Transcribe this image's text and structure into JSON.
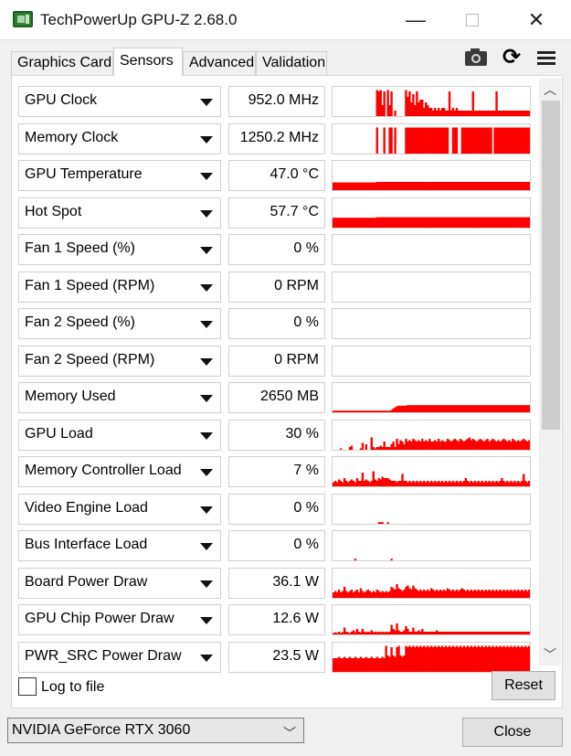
{
  "window": {
    "title": "TechPowerUp GPU-Z 2.68.0",
    "minimize": "—",
    "close": "✕"
  },
  "tabs": [
    {
      "label": "Graphics Card",
      "active": false
    },
    {
      "label": "Sensors",
      "active": true
    },
    {
      "label": "Advanced",
      "active": false
    },
    {
      "label": "Validation",
      "active": false
    }
  ],
  "toolbar": {
    "icons": [
      "camera-icon",
      "refresh-icon",
      "menu-icon"
    ]
  },
  "sensors": [
    {
      "name": "GPU Clock",
      "value": "952.0 MHz",
      "graph": [
        0,
        0,
        0,
        0,
        0,
        0,
        0,
        0,
        0,
        0,
        0,
        0,
        0,
        0,
        0,
        0,
        0,
        0,
        0,
        0,
        0,
        0,
        0,
        0,
        0.95,
        0.9,
        0.95,
        0.4,
        0.9,
        0,
        0.95,
        0.4,
        0.9,
        0,
        0.2,
        0,
        0,
        0,
        0,
        0,
        0.95,
        0.7,
        0.9,
        0.5,
        0.8,
        0.4,
        0.9,
        0.5,
        0.6,
        0.6,
        0.3,
        0.5,
        0.4,
        0.3,
        0.3,
        0.2,
        0.3,
        0.2,
        0.3,
        0.2,
        0.3,
        0.3,
        0.2,
        0.2,
        0.9,
        0.2,
        0.3,
        0.2,
        0.3,
        0.2,
        0.2,
        0.2,
        0.2,
        0.2,
        0.2,
        0.2,
        0.2,
        0.9,
        0.2,
        0.2,
        0.2,
        0.2,
        0.2,
        0.2,
        0.2,
        0.2,
        0.2,
        0.2,
        0.2,
        0.2,
        0.9,
        0.2,
        0.2,
        0.2,
        0.2,
        0.2,
        0.2,
        0.2,
        0.2,
        0.2,
        0.2,
        0.2,
        0.2,
        0.2,
        0.2,
        0.2,
        0.2,
        0.2,
        0.2
      ]
    },
    {
      "name": "Memory Clock",
      "value": "1250.2 MHz",
      "graph": [
        0,
        0,
        0,
        0,
        0,
        0,
        0,
        0,
        0,
        0,
        0,
        0,
        0,
        0,
        0,
        0,
        0,
        0,
        0,
        0,
        0,
        0,
        0,
        0,
        0.95,
        0,
        0,
        0,
        0.95,
        0,
        0,
        0.95,
        0.95,
        0,
        0.95,
        0,
        0,
        0,
        0,
        0,
        0.95,
        0.95,
        0.95,
        0.95,
        0.95,
        0.95,
        0.95,
        0.95,
        0.95,
        0.95,
        0.95,
        0.95,
        0.95,
        0.95,
        0.95,
        0.95,
        0.95,
        0.95,
        0.95,
        0.95,
        0.95,
        0.95,
        0.95,
        0.95,
        0,
        0,
        0.95,
        0.95,
        0.95,
        0,
        0,
        0.95,
        0.95,
        0.95,
        0.95,
        0.95,
        0.95,
        0.95,
        0.95,
        0.95,
        0.95,
        0.95,
        0.95,
        0.95,
        0.95,
        0.95,
        0.95,
        0.95,
        0,
        0.95,
        0.95,
        0.95,
        0.95,
        0.95,
        0.95,
        0.95,
        0.95,
        0.95,
        0.95,
        0.95,
        0.95,
        0.95,
        0.95,
        0.95,
        0.95,
        0.95,
        0.95,
        0.95,
        0.95
      ]
    },
    {
      "name": "GPU Temperature",
      "value": "47.0 °C",
      "graph": [
        0.28,
        0.28,
        0.28,
        0.28,
        0.28,
        0.28,
        0.28,
        0.28,
        0.28,
        0.28,
        0.28,
        0.28,
        0.28,
        0.28,
        0.28,
        0.28,
        0.28,
        0.28,
        0.28,
        0.28,
        0.28,
        0.28,
        0.28,
        0.28,
        0.3,
        0.3,
        0.3,
        0.3,
        0.3,
        0.3,
        0.3,
        0.3,
        0.3,
        0.3,
        0.3,
        0.3,
        0.3,
        0.3,
        0.3,
        0.3,
        0.3,
        0.3,
        0.3,
        0.3,
        0.3,
        0.3,
        0.3,
        0.3,
        0.3,
        0.3,
        0.3,
        0.3,
        0.3,
        0.3,
        0.3,
        0.3,
        0.3,
        0.3,
        0.3,
        0.3,
        0.3,
        0.3,
        0.3,
        0.3,
        0.3,
        0.3,
        0.3,
        0.3,
        0.3,
        0.3,
        0.3,
        0.3,
        0.3,
        0.3,
        0.3,
        0.3,
        0.3,
        0.3,
        0.3,
        0.3,
        0.3,
        0.3,
        0.3,
        0.3,
        0.3,
        0.3,
        0.3,
        0.3,
        0.3,
        0.3,
        0.3,
        0.3,
        0.3,
        0.3,
        0.3,
        0.3,
        0.3,
        0.3,
        0.3,
        0.3,
        0.3,
        0.3,
        0.3,
        0.3,
        0.3,
        0.3,
        0.3,
        0.3,
        0.3
      ]
    },
    {
      "name": "Hot Spot",
      "value": "57.7 °C",
      "graph": [
        0.36,
        0.36,
        0.36,
        0.36,
        0.36,
        0.36,
        0.36,
        0.36,
        0.36,
        0.36,
        0.36,
        0.36,
        0.36,
        0.36,
        0.36,
        0.36,
        0.36,
        0.36,
        0.36,
        0.36,
        0.36,
        0.36,
        0.36,
        0.36,
        0.38,
        0.38,
        0.38,
        0.38,
        0.38,
        0.38,
        0.38,
        0.38,
        0.38,
        0.38,
        0.38,
        0.38,
        0.38,
        0.38,
        0.38,
        0.38,
        0.38,
        0.38,
        0.38,
        0.38,
        0.38,
        0.38,
        0.38,
        0.38,
        0.38,
        0.38,
        0.38,
        0.38,
        0.38,
        0.38,
        0.38,
        0.38,
        0.38,
        0.38,
        0.38,
        0.38,
        0.38,
        0.38,
        0.38,
        0.38,
        0.38,
        0.38,
        0.38,
        0.38,
        0.38,
        0.38,
        0.38,
        0.38,
        0.38,
        0.38,
        0.38,
        0.38,
        0.38,
        0.38,
        0.38,
        0.38,
        0.38,
        0.38,
        0.38,
        0.38,
        0.38,
        0.38,
        0.38,
        0.38,
        0.38,
        0.38,
        0.38,
        0.38,
        0.38,
        0.38,
        0.38,
        0.38,
        0.38,
        0.38,
        0.38,
        0.38,
        0.38,
        0.38,
        0.38,
        0.38,
        0.38,
        0.38,
        0.38,
        0.38,
        0.38
      ]
    },
    {
      "name": "Fan 1 Speed (%)",
      "value": "0 %",
      "graph": []
    },
    {
      "name": "Fan 1 Speed (RPM)",
      "value": "0 RPM",
      "graph": []
    },
    {
      "name": "Fan 2 Speed (%)",
      "value": "0 %",
      "graph": []
    },
    {
      "name": "Fan 2 Speed (RPM)",
      "value": "0 RPM",
      "graph": []
    },
    {
      "name": "Memory Used",
      "value": "2650 MB",
      "graph": [
        0.06,
        0.06,
        0.06,
        0.06,
        0.06,
        0.06,
        0.06,
        0.06,
        0.06,
        0.06,
        0.06,
        0.06,
        0.06,
        0.06,
        0.06,
        0.06,
        0.06,
        0.06,
        0.06,
        0.06,
        0.06,
        0.06,
        0.06,
        0.06,
        0.06,
        0.06,
        0.06,
        0.06,
        0.06,
        0.06,
        0.06,
        0.06,
        0.08,
        0.14,
        0.18,
        0.22,
        0.24,
        0.24,
        0.24,
        0.24,
        0.24,
        0.26,
        0.26,
        0.26,
        0.26,
        0.26,
        0.26,
        0.26,
        0.26,
        0.26,
        0.26,
        0.26,
        0.26,
        0.26,
        0.26,
        0.26,
        0.26,
        0.26,
        0.26,
        0.26,
        0.26,
        0.26,
        0.26,
        0.26,
        0.26,
        0.26,
        0.26,
        0.26,
        0.26,
        0.26,
        0.26,
        0.26,
        0.26,
        0.26,
        0.26,
        0.26,
        0.26,
        0.26,
        0.26,
        0.26,
        0.26,
        0.26,
        0.26,
        0.26,
        0.26,
        0.26,
        0.26,
        0.26,
        0.26,
        0.26,
        0.26,
        0.26,
        0.26,
        0.26,
        0.26,
        0.26,
        0.26,
        0.26,
        0.26,
        0.26,
        0.26,
        0.26,
        0.26,
        0.26,
        0.26,
        0.26,
        0.26,
        0.26,
        0.26
      ]
    },
    {
      "name": "GPU Load",
      "value": "30 %",
      "graph": [
        0,
        0,
        0,
        0,
        0.05,
        0,
        0,
        0,
        0,
        0.1,
        0.15,
        0,
        0,
        0,
        0,
        0.05,
        0.25,
        0,
        0.2,
        0,
        0,
        0.45,
        0.1,
        0.05,
        0.1,
        0.1,
        0.15,
        0.1,
        0.3,
        0.1,
        0.1,
        0.1,
        0.2,
        0.3,
        0.1,
        0.4,
        0.2,
        0.35,
        0.3,
        0.2,
        0.4,
        0.3,
        0.35,
        0.3,
        0.4,
        0.35,
        0.3,
        0.35,
        0.3,
        0.4,
        0.3,
        0.35,
        0.3,
        0.4,
        0.3,
        0.3,
        0.35,
        0.3,
        0.4,
        0.3,
        0.35,
        0.3,
        0.3,
        0.4,
        0.35,
        0.3,
        0.35,
        0.4,
        0.35,
        0.3,
        0.4,
        0.35,
        0.3,
        0.35,
        0.4,
        0.45,
        0.35,
        0.4,
        0.35,
        0.3,
        0.35,
        0.4,
        0.35,
        0.3,
        0.35,
        0.4,
        0.3,
        0.35,
        0.4,
        0.35,
        0.3,
        0.35,
        0.3,
        0.35,
        0.4,
        0.35,
        0.3,
        0.35,
        0.3,
        0.4,
        0.35,
        0.3,
        0.35,
        0.3,
        0.35,
        0.4,
        0.35,
        0.3,
        0.35
      ]
    },
    {
      "name": "Memory Controller Load",
      "value": "7 %",
      "graph": [
        0.15,
        0.2,
        0.15,
        0.25,
        0.2,
        0.15,
        0.3,
        0.2,
        0.15,
        0.2,
        0.25,
        0.2,
        0.15,
        0.3,
        0.2,
        0.2,
        0.5,
        0.2,
        0.25,
        0.2,
        0.15,
        0.2,
        0.55,
        0.25,
        0.2,
        0.3,
        0.25,
        0.35,
        0.3,
        0.3,
        0.3,
        0.25,
        0.2,
        0.2,
        0.2,
        0.15,
        0.2,
        0.2,
        0.45,
        0.2,
        0.2,
        0.15,
        0.2,
        0.15,
        0.2,
        0.15,
        0.2,
        0.15,
        0.2,
        0.15,
        0.2,
        0.15,
        0.2,
        0.15,
        0.2,
        0.15,
        0.2,
        0.15,
        0.2,
        0.15,
        0.2,
        0.15,
        0.2,
        0.15,
        0.2,
        0.15,
        0.2,
        0.15,
        0.2,
        0.15,
        0.2,
        0.15,
        0.2,
        0.3,
        0.2,
        0.15,
        0.2,
        0.15,
        0.2,
        0.15,
        0.2,
        0.15,
        0.2,
        0.15,
        0.2,
        0.15,
        0.2,
        0.15,
        0.2,
        0.15,
        0.2,
        0.15,
        0.2,
        0.3,
        0.2,
        0.15,
        0.2,
        0.15,
        0.2,
        0.15,
        0.2,
        0.15,
        0.2,
        0.15,
        0.2,
        0.45,
        0.2,
        0.15,
        0.2
      ]
    },
    {
      "name": "Video Engine Load",
      "value": "0 %",
      "graph": [
        0,
        0,
        0,
        0,
        0,
        0,
        0,
        0,
        0,
        0,
        0,
        0,
        0,
        0,
        0,
        0,
        0,
        0,
        0,
        0,
        0,
        0,
        0,
        0,
        0,
        0.06,
        0.06,
        0.06,
        0,
        0,
        0.06,
        0,
        0,
        0,
        0,
        0,
        0,
        0,
        0,
        0,
        0,
        0,
        0,
        0,
        0,
        0,
        0,
        0,
        0,
        0,
        0,
        0,
        0,
        0,
        0,
        0,
        0,
        0,
        0,
        0,
        0,
        0,
        0,
        0,
        0,
        0,
        0,
        0,
        0,
        0,
        0,
        0,
        0,
        0,
        0,
        0,
        0,
        0,
        0,
        0,
        0,
        0,
        0,
        0,
        0,
        0,
        0,
        0,
        0,
        0,
        0,
        0,
        0,
        0,
        0,
        0,
        0,
        0,
        0,
        0,
        0,
        0,
        0,
        0,
        0,
        0,
        0,
        0,
        0
      ]
    },
    {
      "name": "Bus Interface Load",
      "value": "0 %",
      "graph": [
        0,
        0,
        0,
        0,
        0,
        0,
        0,
        0,
        0,
        0,
        0,
        0,
        0.06,
        0,
        0,
        0,
        0,
        0,
        0,
        0,
        0,
        0,
        0,
        0,
        0,
        0,
        0,
        0,
        0,
        0,
        0,
        0,
        0.06,
        0,
        0,
        0,
        0,
        0,
        0,
        0,
        0,
        0,
        0,
        0,
        0,
        0,
        0,
        0,
        0,
        0,
        0,
        0,
        0,
        0,
        0,
        0,
        0,
        0,
        0,
        0,
        0,
        0,
        0,
        0,
        0,
        0,
        0,
        0,
        0,
        0,
        0,
        0,
        0,
        0,
        0,
        0,
        0,
        0,
        0,
        0,
        0,
        0,
        0,
        0,
        0,
        0,
        0,
        0,
        0,
        0,
        0,
        0,
        0,
        0,
        0,
        0,
        0,
        0,
        0,
        0,
        0,
        0,
        0,
        0,
        0,
        0,
        0,
        0,
        0
      ]
    },
    {
      "name": "Board Power Draw",
      "value": "36.1 W",
      "graph": [
        0.2,
        0.25,
        0.2,
        0.3,
        0.2,
        0.25,
        0.4,
        0.25,
        0.2,
        0.25,
        0.3,
        0.2,
        0.25,
        0.3,
        0.2,
        0.35,
        0.25,
        0.2,
        0.25,
        0.3,
        0.25,
        0.2,
        0.25,
        0.2,
        0.3,
        0.25,
        0.2,
        0.25,
        0.2,
        0.25,
        0.2,
        0.25,
        0.4,
        0.35,
        0.3,
        0.5,
        0.35,
        0.3,
        0.25,
        0.3,
        0.4,
        0.45,
        0.35,
        0.3,
        0.45,
        0.35,
        0.3,
        0.25,
        0.3,
        0.25,
        0.3,
        0.25,
        0.3,
        0.25,
        0.35,
        0.3,
        0.25,
        0.3,
        0.25,
        0.3,
        0.25,
        0.3,
        0.25,
        0.35,
        0.3,
        0.25,
        0.3,
        0.25,
        0.3,
        0.25,
        0.3,
        0.35,
        0.3,
        0.25,
        0.3,
        0.25,
        0.3,
        0.25,
        0.3,
        0.25,
        0.3,
        0.25,
        0.3,
        0.25,
        0.3,
        0.25,
        0.3,
        0.25,
        0.3,
        0.25,
        0.3,
        0.25,
        0.3,
        0.25,
        0.3,
        0.25,
        0.3,
        0.25,
        0.3,
        0.25,
        0.3,
        0.25,
        0.3,
        0.25,
        0.3,
        0.25,
        0.3,
        0.25,
        0.3
      ]
    },
    {
      "name": "GPU Chip Power Draw",
      "value": "12.6 W",
      "graph": [
        0.05,
        0.08,
        0.05,
        0.1,
        0.05,
        0.08,
        0.25,
        0.1,
        0.08,
        0.05,
        0.1,
        0.15,
        0.08,
        0.2,
        0.1,
        0.08,
        0.2,
        0.1,
        0.08,
        0.1,
        0.08,
        0.15,
        0.08,
        0.1,
        0.08,
        0.1,
        0.08,
        0.1,
        0.08,
        0.1,
        0.08,
        0.1,
        0.35,
        0.2,
        0.15,
        0.4,
        0.15,
        0.1,
        0.1,
        0.15,
        0.3,
        0.2,
        0.1,
        0.1,
        0.25,
        0.1,
        0.1,
        0.15,
        0.1,
        0.2,
        0.1,
        0.1,
        0.1,
        0.1,
        0.1,
        0.1,
        0.1,
        0.15,
        0.1,
        0.1,
        0.1,
        0.1,
        0.1,
        0.1,
        0.1,
        0.1,
        0.1,
        0.1,
        0.1,
        0.1,
        0.1,
        0.1,
        0.1,
        0.1,
        0.1,
        0.1,
        0.1,
        0.1,
        0.1,
        0.1,
        0.1,
        0.1,
        0.1,
        0.1,
        0.1,
        0.1,
        0.1,
        0.1,
        0.1,
        0.1,
        0.1,
        0.1,
        0.1,
        0.1,
        0.1,
        0.1,
        0.1,
        0.1,
        0.1,
        0.1,
        0.1,
        0.1,
        0.1,
        0.1,
        0.1,
        0.1,
        0.1,
        0.1,
        0.1
      ]
    },
    {
      "name": "PWR_SRC Power Draw",
      "value": "23.5 W",
      "graph": [
        0.5,
        0.5,
        0.5,
        0.55,
        0.5,
        0.5,
        0.55,
        0.5,
        0.5,
        0.55,
        0.5,
        0.5,
        0.55,
        0.5,
        0.5,
        0.55,
        0.5,
        0.5,
        0.55,
        0.5,
        0.5,
        0.55,
        0.5,
        0.5,
        0.55,
        0.5,
        0.5,
        0.55,
        0.5,
        0.95,
        0.6,
        0.55,
        0.9,
        0.6,
        0.55,
        0.9,
        0.95,
        0.6,
        0.55,
        0.6,
        0.95,
        0.9,
        0.95,
        0.9,
        0.95,
        0.9,
        0.95,
        0.9,
        0.95,
        0.9,
        0.95,
        0.9,
        0.95,
        0.9,
        0.95,
        0.9,
        0.95,
        0.9,
        0.95,
        0.9,
        0.95,
        0.9,
        0.95,
        0.9,
        0.95,
        0.9,
        0.95,
        0.9,
        0.95,
        0.9,
        0.95,
        0.9,
        0.95,
        0.9,
        0.95,
        0.9,
        0.95,
        0.9,
        0.95,
        0.9,
        0.95,
        0.9,
        0.95,
        0.9,
        0.95,
        0.9,
        0.95,
        0.9,
        0.95,
        0.9,
        0.95,
        0.9,
        0.95,
        0.9,
        0.95,
        0.9,
        0.95,
        0.9,
        0.95,
        0.9,
        0.95,
        0.9,
        0.95,
        0.9,
        0.95,
        0.9,
        0.95,
        0.9,
        0.95
      ]
    }
  ],
  "footer": {
    "log_label": "Log to file",
    "log_checked": false,
    "reset_label": "Reset",
    "gpu_selected": "NVIDIA GeForce RTX 3060",
    "close_label": "Close"
  },
  "colors": {
    "graph": "#ff0000"
  }
}
